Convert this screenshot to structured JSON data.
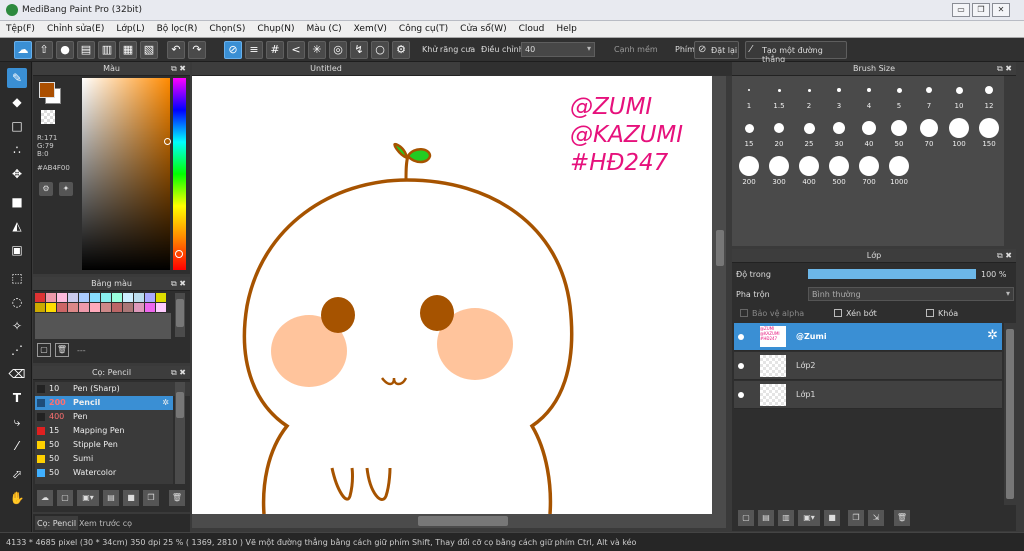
{
  "window": {
    "title": "MediBang Paint Pro (32bit)"
  },
  "menu": [
    "Tệp(F)",
    "Chỉnh sửa(E)",
    "Lớp(L)",
    "Bộ lọc(R)",
    "Chọn(S)",
    "Chụp(N)",
    "Màu (C)",
    "Xem(V)",
    "Công cụ(T)",
    "Cửa sổ(W)",
    "Cloud",
    "Help"
  ],
  "toolbar": {
    "antialias_label": "Khử răng cưa",
    "adjust_label": "Điều chỉnh",
    "adjust_value": "40",
    "soft_edge_label": "Cạnh mềm",
    "key_label": "Phím",
    "reset_label": "Đặt lại",
    "straight_line_label": "Tạo một đường thẳng"
  },
  "color_panel": {
    "title": "Màu",
    "r": "R:171",
    "g": "G:79",
    "b": "B:0",
    "hex": "#AB4F00",
    "primary_color": "#AB4F00",
    "secondary_color": "#FFFFFF"
  },
  "palette_panel": {
    "title": "Bảng màu",
    "swatches": [
      "#d33",
      "#e9a",
      "#fbd",
      "#cce",
      "#acf",
      "#8df",
      "#8ee",
      "#9fd",
      "#cef",
      "#bde",
      "#aaf",
      "#dd0",
      "#ca0",
      "#fd0",
      "#c66",
      "#d88",
      "#e9a",
      "#fab",
      "#c88",
      "#b66",
      "#a77",
      "#d9b",
      "#e6e",
      "#fcf"
    ],
    "footer_text": "---"
  },
  "brush_panel": {
    "title": "Cọ: Pencil",
    "items": [
      {
        "size": "10",
        "name": "Pen (Sharp)",
        "color": "#222222"
      },
      {
        "size": "200",
        "name": "Pencil",
        "color": "#1e4d7a"
      },
      {
        "size": "400",
        "name": "Pen",
        "color": "#222222"
      },
      {
        "size": "15",
        "name": "Mapping Pen",
        "color": "#e02020"
      },
      {
        "size": "50",
        "name": "Stipple Pen",
        "color": "#ffd000"
      },
      {
        "size": "50",
        "name": "Sumi",
        "color": "#ffd000"
      },
      {
        "size": "50",
        "name": "Watercolor",
        "color": "#40b0ff"
      }
    ],
    "tabs": [
      "Cọ: Pencil",
      "Xem trước cọ"
    ]
  },
  "canvas": {
    "tab_title": "Untitled",
    "watermark": [
      "@ZUMI",
      "@KAZUMI",
      "#HĐ247"
    ]
  },
  "brush_size_panel": {
    "title": "Brush Size",
    "sizes": [
      "1",
      "1.5",
      "2",
      "3",
      "4",
      "5",
      "7",
      "10",
      "12",
      "15",
      "20",
      "25",
      "30",
      "40",
      "50",
      "70",
      "100",
      "150",
      "200",
      "300",
      "400",
      "500",
      "700",
      "1000"
    ]
  },
  "layer_panel": {
    "title": "Lớp",
    "opacity_label": "Độ trong",
    "opacity_value": "100 %",
    "opacity_fraction": 1.0,
    "blend_label": "Pha trộn",
    "blend_value": "Bình thường",
    "protect_alpha_label": "Bảo vệ alpha",
    "clip_label": "Xén bớt",
    "lock_label": "Khóa",
    "layers": [
      {
        "name": "@Zumi",
        "selected": true
      },
      {
        "name": "Lớp2",
        "selected": false
      },
      {
        "name": "Lớp1",
        "selected": false
      }
    ]
  },
  "status_bar": {
    "text": "4133 * 4685 pixel  (30 * 34cm)  350 dpi  25 %  ( 1369, 2810 )  Vẽ một đường thẳng bằng cách giữ phím Shift, Thay đổi cỡ cọ bằng cách giữ phím Ctrl, Alt và kéo"
  }
}
